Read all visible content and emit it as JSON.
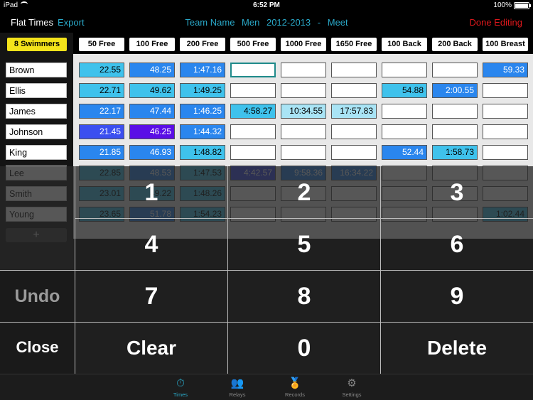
{
  "status": {
    "device": "iPad",
    "time": "6:52 PM",
    "battery": "100%"
  },
  "nav": {
    "title": "Flat Times",
    "export": "Export",
    "team": "Team Name",
    "group": "Men",
    "season": "2012-2013",
    "dash": "-",
    "meet": "Meet",
    "done": "Done Editing"
  },
  "swimmer_count": "8 Swimmers",
  "events": [
    "50 Free",
    "100 Free",
    "200 Free",
    "500 Free",
    "1000 Free",
    "1650 Free",
    "100 Back",
    "200 Back",
    "100 Breast"
  ],
  "swimmers": [
    {
      "name": "Brown",
      "times": [
        "22.55",
        "48.25",
        "1:47.16",
        "",
        "",
        "",
        "",
        "",
        "59.33"
      ]
    },
    {
      "name": "Ellis",
      "times": [
        "22.71",
        "49.62",
        "1:49.25",
        "",
        "",
        "",
        "54.88",
        "2:00.55",
        ""
      ]
    },
    {
      "name": "James",
      "times": [
        "22.17",
        "47.44",
        "1:46.25",
        "4:58.27",
        "10:34.55",
        "17:57.83",
        "",
        "",
        ""
      ]
    },
    {
      "name": "Johnson",
      "times": [
        "21.45",
        "46.25",
        "1:44.32",
        "",
        "",
        "",
        "",
        "",
        ""
      ]
    },
    {
      "name": "King",
      "times": [
        "21.85",
        "46.93",
        "1:48.82",
        "",
        "",
        "",
        "52.44",
        "1:58.73",
        ""
      ]
    },
    {
      "name": "Lee",
      "times": [
        "22.85",
        "48.53",
        "1:47.53",
        "4:42.57",
        "9:58.36",
        "16:34.22",
        "",
        "",
        ""
      ]
    },
    {
      "name": "Smith",
      "times": [
        "23.01",
        "49.22",
        "1:48.26",
        "",
        "",
        "",
        "",
        "",
        ""
      ]
    },
    {
      "name": "Young",
      "times": [
        "23.65",
        "51.78",
        "1:54.23",
        "",
        "",
        "",
        "",
        "",
        "1:02.44"
      ]
    }
  ],
  "cell_shades": [
    [
      2,
      3,
      3,
      0,
      0,
      0,
      0,
      0,
      3
    ],
    [
      2,
      2,
      2,
      0,
      0,
      0,
      2,
      3,
      0
    ],
    [
      3,
      3,
      3,
      2,
      1,
      1,
      0,
      0,
      0
    ],
    [
      4,
      5,
      3,
      0,
      0,
      0,
      0,
      0,
      0
    ],
    [
      3,
      3,
      2,
      0,
      0,
      0,
      3,
      2,
      0
    ],
    [
      2,
      3,
      2,
      4,
      3,
      3,
      0,
      0,
      0
    ],
    [
      2,
      2,
      2,
      0,
      0,
      0,
      0,
      0,
      0
    ],
    [
      2,
      3,
      2,
      0,
      0,
      0,
      0,
      0,
      2
    ]
  ],
  "add_label": "+",
  "keypad": {
    "k1": "1",
    "k2": "2",
    "k3": "3",
    "k4": "4",
    "k5": "5",
    "k6": "6",
    "k7": "7",
    "k8": "8",
    "k9": "9",
    "k0": "0",
    "clear": "Clear",
    "delete": "Delete",
    "undo": "Undo",
    "close": "Close"
  },
  "tabs": [
    {
      "label": "Times",
      "icon": "stopwatch-icon"
    },
    {
      "label": "Relays",
      "icon": "group-icon"
    },
    {
      "label": "Records",
      "icon": "medal-icon"
    },
    {
      "label": "Settings",
      "icon": "gear-icon"
    }
  ],
  "colors": {
    "accent": "#2aa9c9",
    "done": "#e0181c",
    "badge": "#f4e31b"
  }
}
